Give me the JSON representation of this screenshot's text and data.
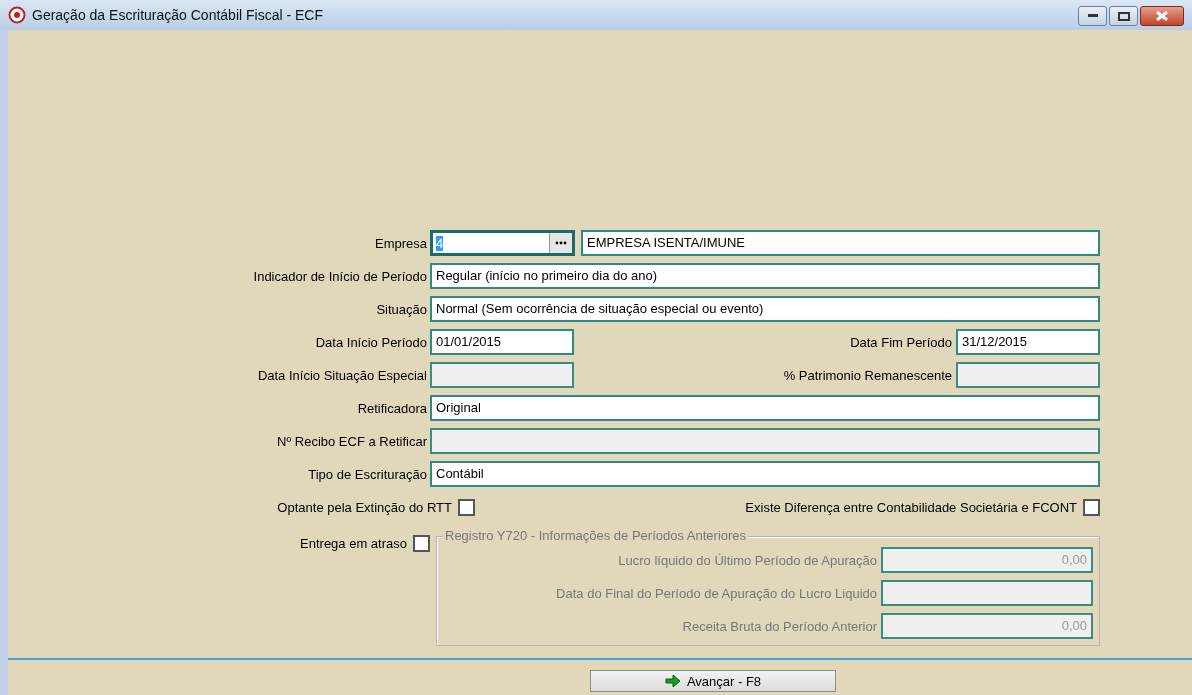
{
  "window": {
    "title": "Geração da Escrituração Contábil Fiscal - ECF"
  },
  "empresa": {
    "label": "Empresa",
    "code": "4",
    "code_highlighted": true,
    "focused": true,
    "name": "EMPRESA ISENTA/IMUNE"
  },
  "rows": [
    {
      "kind": "full",
      "fields": [
        {
          "label": "Indicador de Início de Período",
          "value": "Regular (início no primeiro dia do ano)",
          "disabled": false
        }
      ]
    },
    {
      "kind": "full",
      "fields": [
        {
          "label": "Situação",
          "value": "Normal (Sem ocorrência de situação especial ou evento)",
          "disabled": false
        }
      ]
    },
    {
      "kind": "pair",
      "fields": [
        {
          "label": "Data Início Período",
          "value": "01/01/2015",
          "disabled": false
        },
        {
          "label": "Data Fim Período",
          "value": "31/12/2015",
          "disabled": false
        }
      ]
    },
    {
      "kind": "pair",
      "fields": [
        {
          "label": "Data Início Situação Especial",
          "disabled": true
        },
        {
          "label": "% Patrimonio Remanescente",
          "disabled": true
        }
      ]
    },
    {
      "kind": "full",
      "fields": [
        {
          "label": "Retificadora",
          "value": "Original",
          "disabled": false
        }
      ]
    },
    {
      "kind": "full",
      "fields": [
        {
          "label": "Nº Recibo ECF a Retificar",
          "disabled": true
        }
      ]
    },
    {
      "kind": "full",
      "fields": [
        {
          "label": "Tipo de Escrituração",
          "value": "Contábil",
          "disabled": false
        }
      ]
    }
  ],
  "checks": [
    {
      "label": "Optante pela Extinção do RTT",
      "checked": false
    },
    {
      "label": "Existe Diferença entre Contabilidade Societária e FCONT",
      "checked": false
    }
  ],
  "late": {
    "label": "Entrega em atraso",
    "checked": false
  },
  "group": {
    "title": "Registro Y720 - Informações de Períodos Anteriores",
    "disabled": true,
    "fields": [
      {
        "label": "Lucro líquido do Último Período de Apuração",
        "value": "0,00"
      },
      {
        "label": "Data do Final do Período de Apuração do Lucro Liquido"
      },
      {
        "label": "Receita Bruta do Período Anterior",
        "value": "0,00"
      }
    ]
  },
  "buttons": [
    {
      "label": "Avançar - F8"
    }
  ]
}
